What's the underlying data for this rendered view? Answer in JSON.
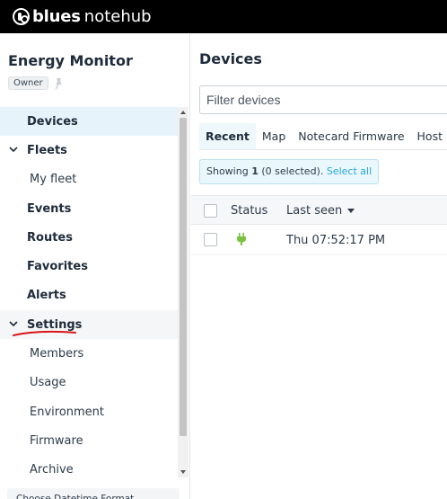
{
  "brand": {
    "bold": "blues",
    "light": "notehub"
  },
  "sidebar": {
    "project_title": "Energy Monitor",
    "role_badge": "Owner",
    "items": [
      {
        "label": "Devices"
      },
      {
        "label": "Fleets"
      },
      {
        "label": "My fleet"
      },
      {
        "label": "Events"
      },
      {
        "label": "Routes"
      },
      {
        "label": "Favorites"
      },
      {
        "label": "Alerts"
      },
      {
        "label": "Settings"
      },
      {
        "label": "Members"
      },
      {
        "label": "Usage"
      },
      {
        "label": "Environment"
      },
      {
        "label": "Firmware"
      },
      {
        "label": "Archive"
      }
    ],
    "bottom_button": "Choose Datetime Format"
  },
  "main": {
    "title": "Devices",
    "filter_placeholder": "Filter devices",
    "tabs": [
      "Recent",
      "Map",
      "Notecard Firmware",
      "Host Firmware"
    ],
    "selection": {
      "prefix": "Showing ",
      "count": "1",
      "selected": " (0 selected).",
      "select_all": "Select all"
    },
    "table": {
      "headers": {
        "status": "Status",
        "last_seen": "Last seen"
      },
      "rows": [
        {
          "status_icon": "plug-icon",
          "last_seen": "Thu 07:52:17 PM"
        }
      ]
    }
  },
  "colors": {
    "accent": "#2aa7d8",
    "selected_bg": "#e6f3fa",
    "status_green": "#7cc242",
    "annotation_red": "#d9151a"
  }
}
